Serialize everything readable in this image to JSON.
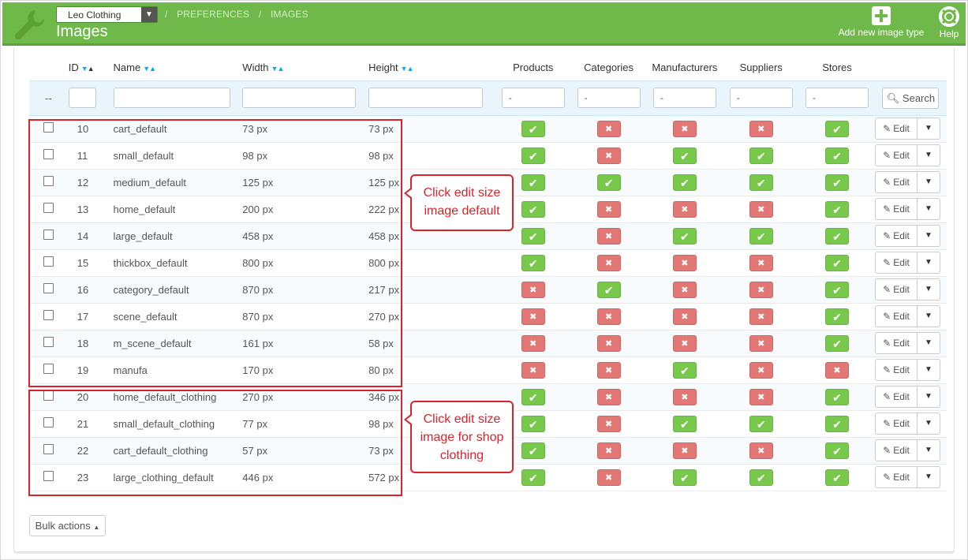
{
  "header": {
    "shop_select": "Leo Clothing",
    "breadcrumb": [
      "PREFERENCES",
      "/",
      "IMAGES"
    ],
    "title": "Images",
    "add_label": "Add new image type",
    "help_label": "Help"
  },
  "columns": {
    "id": "ID",
    "name": "Name",
    "width": "Width",
    "height": "Height",
    "products": "Products",
    "categories": "Categories",
    "manufacturers": "Manufacturers",
    "suppliers": "Suppliers",
    "stores": "Stores"
  },
  "filters": {
    "dash": "--",
    "select_placeholder": "-",
    "search_label": "Search"
  },
  "rows": [
    {
      "id": "10",
      "name": "cart_default",
      "width": "73 px",
      "height": "73 px",
      "flags": [
        true,
        false,
        false,
        false,
        true
      ]
    },
    {
      "id": "11",
      "name": "small_default",
      "width": "98 px",
      "height": "98 px",
      "flags": [
        true,
        false,
        true,
        true,
        true
      ]
    },
    {
      "id": "12",
      "name": "medium_default",
      "width": "125 px",
      "height": "125 px",
      "flags": [
        true,
        true,
        true,
        true,
        true
      ]
    },
    {
      "id": "13",
      "name": "home_default",
      "width": "200 px",
      "height": "222 px",
      "flags": [
        true,
        false,
        false,
        false,
        true
      ]
    },
    {
      "id": "14",
      "name": "large_default",
      "width": "458 px",
      "height": "458 px",
      "flags": [
        true,
        false,
        true,
        true,
        true
      ]
    },
    {
      "id": "15",
      "name": "thickbox_default",
      "width": "800 px",
      "height": "800 px",
      "flags": [
        true,
        false,
        false,
        false,
        true
      ]
    },
    {
      "id": "16",
      "name": "category_default",
      "width": "870 px",
      "height": "217 px",
      "flags": [
        false,
        true,
        false,
        false,
        true
      ]
    },
    {
      "id": "17",
      "name": "scene_default",
      "width": "870 px",
      "height": "270 px",
      "flags": [
        false,
        false,
        false,
        false,
        true
      ]
    },
    {
      "id": "18",
      "name": "m_scene_default",
      "width": "161 px",
      "height": "58 px",
      "flags": [
        false,
        false,
        false,
        false,
        true
      ]
    },
    {
      "id": "19",
      "name": "manufa",
      "width": "170 px",
      "height": "80 px",
      "flags": [
        false,
        false,
        true,
        false,
        false
      ]
    },
    {
      "id": "20",
      "name": "home_default_clothing",
      "width": "270 px",
      "height": "346 px",
      "flags": [
        true,
        false,
        false,
        false,
        true
      ]
    },
    {
      "id": "21",
      "name": "small_default_clothing",
      "width": "77 px",
      "height": "98 px",
      "flags": [
        true,
        false,
        true,
        true,
        true
      ]
    },
    {
      "id": "22",
      "name": "cart_default_clothing",
      "width": "57 px",
      "height": "73 px",
      "flags": [
        true,
        false,
        false,
        false,
        true
      ]
    },
    {
      "id": "23",
      "name": "large_clothing_default",
      "width": "446 px",
      "height": "572 px",
      "flags": [
        true,
        false,
        true,
        true,
        true
      ]
    }
  ],
  "row_actions": {
    "edit_label": "Edit"
  },
  "annotations": {
    "callout1": "Click edit size image default",
    "callout2": "Click edit size image for shop clothing"
  },
  "footer": {
    "bulk_label": "Bulk actions"
  },
  "colors": {
    "header_green": "#6fb94a",
    "yes": "#78c84b",
    "no": "#e17875",
    "accent": "#00aff0",
    "annotation_red": "#d9232b"
  }
}
